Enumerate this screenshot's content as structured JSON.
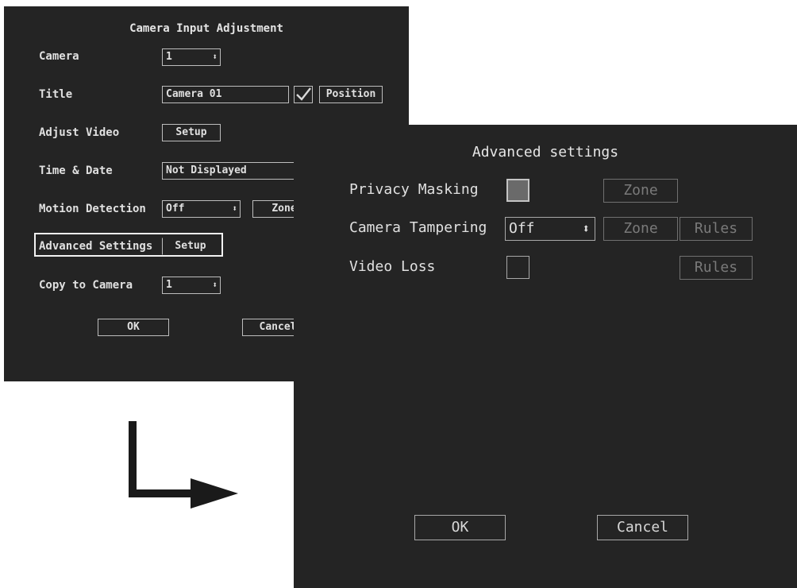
{
  "camera_dialog": {
    "title": "Camera Input Adjustment",
    "camera_label": "Camera",
    "camera_value": "1",
    "title_label": "Title",
    "title_value": "Camera 01",
    "title_display_checked": true,
    "position_button": "Position",
    "adjust_video_label": "Adjust Video",
    "adjust_video_button": "Setup",
    "time_date_label": "Time & Date",
    "time_date_value": "Not Displayed",
    "motion_label": "Motion Detection",
    "motion_value": "Off",
    "motion_zone_button": "Zone",
    "advanced_label": "Advanced Settings",
    "advanced_button": "Setup",
    "copy_label": "Copy to Camera",
    "copy_value": "1",
    "ok_button": "OK",
    "cancel_button": "Cancel"
  },
  "advanced_dialog": {
    "title": "Advanced settings",
    "privacy_label": "Privacy Masking",
    "privacy_zone_button": "Zone",
    "tampering_label": "Camera Tampering",
    "tampering_value": "Off",
    "tampering_zone_button": "Zone",
    "tampering_rules_button": "Rules",
    "video_loss_label": "Video Loss",
    "video_loss_rules_button": "Rules",
    "ok_button": "OK",
    "cancel_button": "Cancel"
  },
  "icons": {
    "spinner": "up-down-arrows-icon",
    "check": "checkmark-icon",
    "flow": "right-angle-arrow-icon"
  },
  "colors": {
    "panel_background": "#242424",
    "text": "#e0e0e0",
    "disabled_text": "#7a7a7a",
    "privacy_checkbox_fill": "#6a6a6a"
  }
}
